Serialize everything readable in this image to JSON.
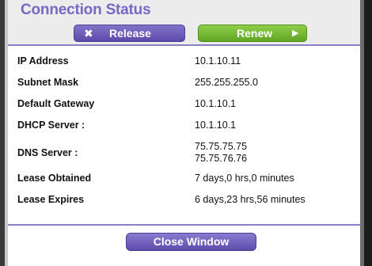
{
  "title": "Connection Status",
  "buttons": {
    "release_icon": "close-icon",
    "release_label": "Release",
    "renew_label": "Renew",
    "renew_icon": "play-icon",
    "close_label": "Close Window"
  },
  "rows": [
    {
      "label": "IP Address",
      "value": "10.1.10.11"
    },
    {
      "label": "Subnet Mask",
      "value": "255.255.255.0"
    },
    {
      "label": "Default Gateway",
      "value": "10.1.10.1"
    },
    {
      "label": "DHCP Server :",
      "value": "10.1.10.1"
    },
    {
      "label": "DNS Server :",
      "values": [
        "75.75.75.75",
        "75.75.76.76"
      ]
    },
    {
      "label": "Lease Obtained",
      "value": "7 days,0 hrs,0 minutes"
    },
    {
      "label": "Lease Expires",
      "value": "6 days,23 hrs,56 minutes"
    }
  ],
  "colors": {
    "title": "#7768c4",
    "release": "#6a5bb8",
    "renew": "#72b837",
    "divider": "#8a7fc4"
  }
}
